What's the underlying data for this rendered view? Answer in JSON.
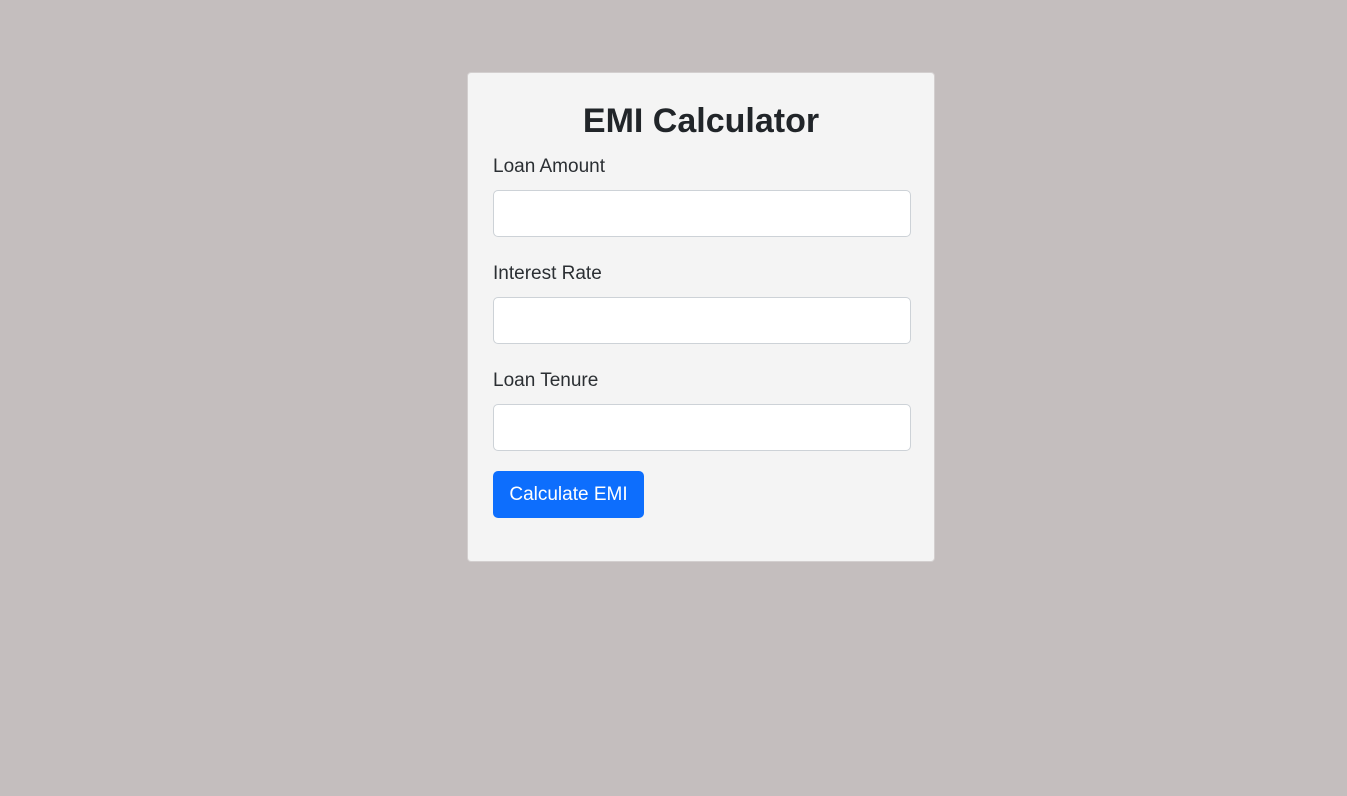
{
  "page": {
    "background_color": "#c4bebe"
  },
  "calculator": {
    "title": "EMI Calculator",
    "fields": [
      {
        "label": "Loan Amount",
        "value": "",
        "placeholder": ""
      },
      {
        "label": "Interest Rate",
        "value": "",
        "placeholder": ""
      },
      {
        "label": "Loan Tenure",
        "value": "",
        "placeholder": ""
      }
    ],
    "submit_label": "Calculate EMI",
    "accent_color": "#0d6efd",
    "card_color": "#f4f4f4"
  }
}
